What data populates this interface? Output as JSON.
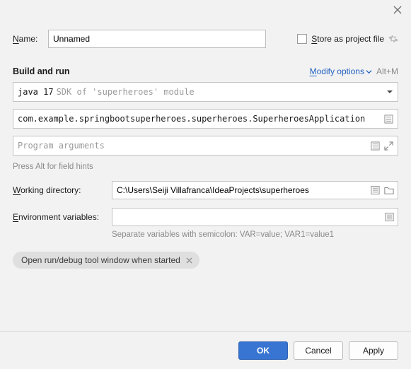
{
  "labels": {
    "name": "ame:",
    "name_prefix": "N",
    "store_prefix": "S",
    "store": "tore as project file",
    "modify_prefix": "M",
    "modify": "odify options",
    "modify_shortcut": "Alt+M",
    "section_title": "Build and run",
    "field_hint": "Press Alt for field hints",
    "working_prefix": "W",
    "working": "orking directory:",
    "env_prefix": "E",
    "env": "nvironment variables:",
    "sep_hint": "Separate variables with semicolon: VAR=value; VAR1=value1",
    "chip": "Open run/debug tool window when started"
  },
  "values": {
    "name": "Unnamed",
    "jdk_main": "java 17",
    "jdk_muted": "SDK of 'superheroes' module",
    "main_class": "com.example.springbootsuperheroes.superheroes.SuperheroesApplication",
    "program_args_placeholder": "Program arguments",
    "working_dir": "C:\\Users\\Seiji Villafranca\\IdeaProjects\\superheroes",
    "env_vars": ""
  },
  "buttons": {
    "ok": "OK",
    "cancel": "Cancel",
    "apply": "Apply"
  }
}
